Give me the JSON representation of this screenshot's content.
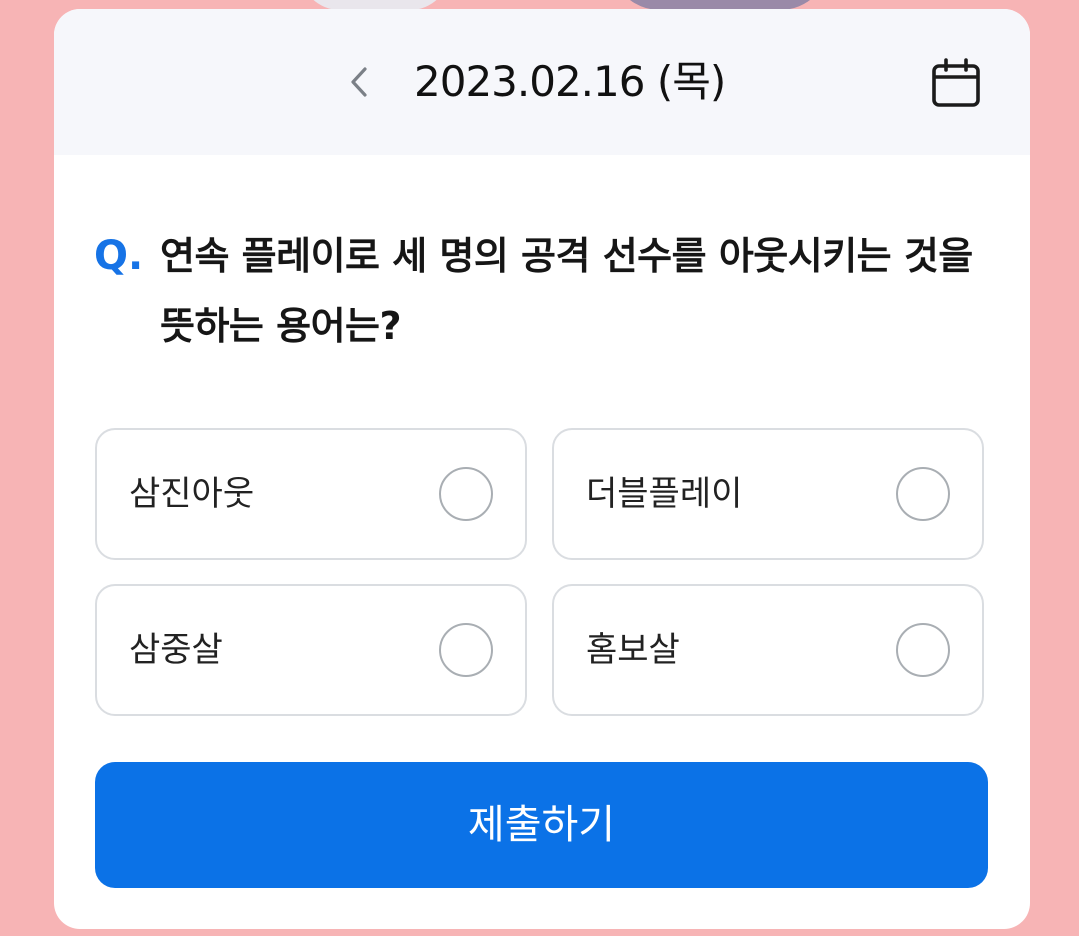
{
  "header": {
    "date_text": "2023.02.16 (목)",
    "prev_icon": "chevron-left-icon",
    "calendar_icon": "calendar-icon"
  },
  "question": {
    "prefix": "Q.",
    "text": "연속 플레이로 세 명의 공격 선수를 아웃시키는 것을 뜻하는 용어는?"
  },
  "options": [
    {
      "label": "삼진아웃",
      "selected": false
    },
    {
      "label": "더블플레이",
      "selected": false
    },
    {
      "label": "삼중살",
      "selected": false
    },
    {
      "label": "홈보살",
      "selected": false
    }
  ],
  "submit": {
    "label": "제출하기"
  },
  "colors": {
    "background": "#f7b4b5",
    "card": "#ffffff",
    "header": "#f6f7fb",
    "accent": "#0b72e7",
    "question_mark": "#1673e6"
  }
}
